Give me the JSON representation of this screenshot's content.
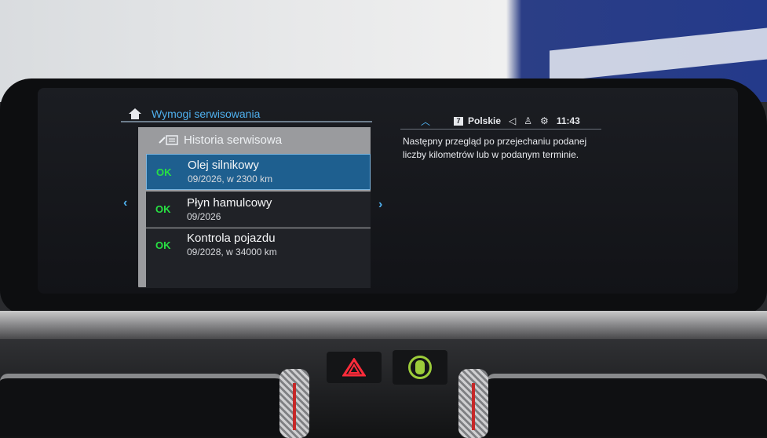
{
  "screen": {
    "title": "Wymogi serwisowania",
    "list_header": "Historia serwisowa",
    "items": [
      {
        "status": "OK",
        "name": "Olej silnikowy",
        "detail": "09/2026, w 2300 km",
        "selected": true
      },
      {
        "status": "OK",
        "name": "Płyn hamulcowy",
        "detail": "09/2026",
        "selected": false
      },
      {
        "status": "OK",
        "name": "Kontrola pojazdu",
        "detail": "09/2028, w 34000 km",
        "selected": false
      }
    ],
    "info_text": "Następny przegląd po przejechaniu podanej liczby kilometrów lub w podanym terminie."
  },
  "status_bar": {
    "badge": "7",
    "language": "Polskie",
    "time": "11:43"
  },
  "colors": {
    "accent": "#4fb0ee",
    "ok_green": "#28e043",
    "selected_bg": "#1e5f8f",
    "panel_header_bg": "#9a9b9e",
    "screen_bg": "#15171b"
  },
  "icons": {
    "home": "home-icon",
    "history": "service-history-icon",
    "nav_left": "chevron-left-icon",
    "nav_right": "chevron-right-icon",
    "up": "chevron-up-icon",
    "sound": "speaker-icon",
    "user": "user-icon",
    "connect": "connected-icon",
    "hazard": "hazard-triangle-icon",
    "traffic": "traffic-light-icon"
  }
}
